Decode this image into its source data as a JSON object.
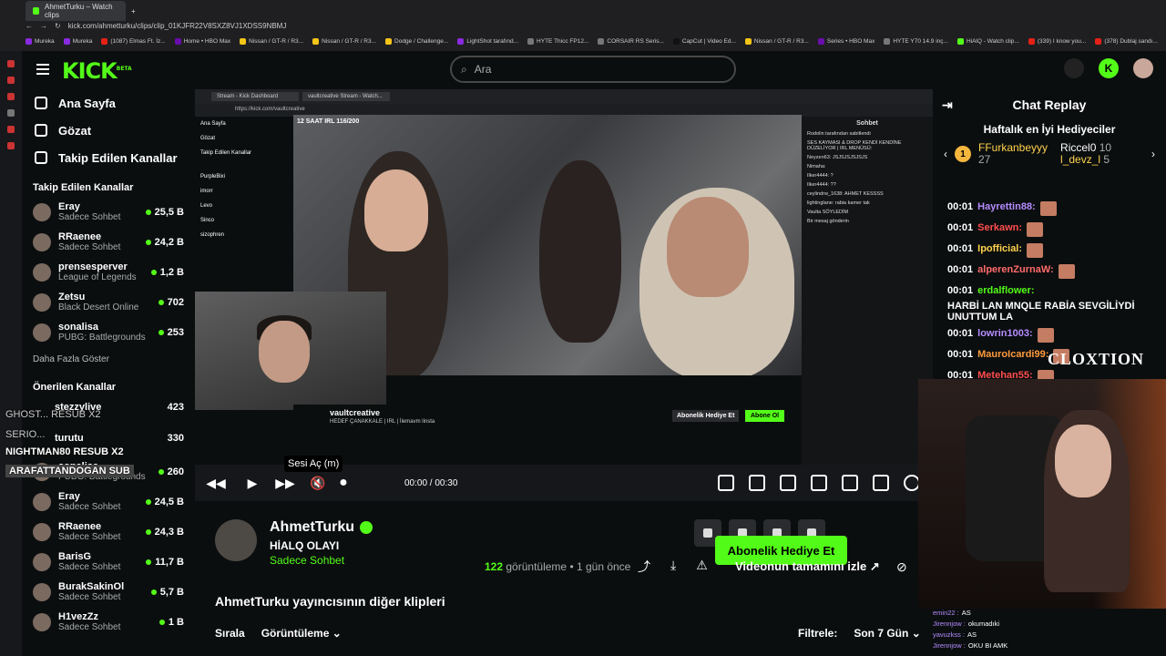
{
  "browser": {
    "tab_title": "AhmetTurku – Watch clips",
    "url": "kick.com/ahmetturku/clips/clip_01KJFR22V8SXZ8VJ1XDSS9NBMJ",
    "bookmarks": [
      "Mureka",
      "Mureka",
      "(1087) Elmas Ft. İz...",
      "Home • HBO Max",
      "Nissan / GT-R / R3...",
      "Nissan / GT-R / R3...",
      "Dodge / Challenge...",
      "LightShot tarafınd...",
      "HYTE Thicc FP12...",
      "CORSAIR RS Seris...",
      "CapCut | Video Ed...",
      "Nissan / GT-R / R3...",
      "Series • HBO Max",
      "HYTE Y70 14.9 inç...",
      "HiAlQ - Watch clip...",
      "(339) I know you...",
      "(378) Dublaj sandı..."
    ],
    "bookmark_colors": [
      "#8a2be2",
      "#8a2be2",
      "#e62117",
      "#6a0dad",
      "#f5c518",
      "#f5c518",
      "#f5c518",
      "#8a2be2",
      "#777777",
      "#777777",
      "#111111",
      "#f5c518",
      "#6a0dad",
      "#777777",
      "#53fc18",
      "#e62117",
      "#e62117"
    ]
  },
  "header": {
    "logo": "KICK",
    "logo_sup": "BETA",
    "search_placeholder": "Ara"
  },
  "sidebar": {
    "nav": [
      {
        "label": "Ana Sayfa",
        "icon": "home-icon"
      },
      {
        "label": "Gözat",
        "icon": "browse-icon"
      },
      {
        "label": "Takip Edilen Kanallar",
        "icon": "heart-icon"
      }
    ],
    "followed_title": "Takip Edilen Kanallar",
    "followed": [
      {
        "name": "Eray",
        "category": "Sadece Sohbet",
        "viewers": "25,5 B"
      },
      {
        "name": "RRaenee",
        "category": "Sadece Sohbet",
        "viewers": "24,2 B"
      },
      {
        "name": "prensesperver",
        "category": "League of Legends",
        "viewers": "1,2 B"
      },
      {
        "name": "Zetsu",
        "category": "Black Desert Online",
        "viewers": "702"
      },
      {
        "name": "sonalisa",
        "category": "PUBG: Battlegrounds",
        "viewers": "253"
      }
    ],
    "show_more": "Daha Fazla Göster",
    "recommended_title": "Önerilen Kanallar",
    "recommended": [
      {
        "name": "sonalisa",
        "category": "PUBG: Battlegrounds",
        "viewers": "260"
      },
      {
        "name": "Eray",
        "category": "Sadece Sohbet",
        "viewers": "24,5 B"
      },
      {
        "name": "RRaenee",
        "category": "Sadece Sohbet",
        "viewers": "24,3 B"
      },
      {
        "name": "BarisG",
        "category": "Sadece Sohbet",
        "viewers": "11,7 B"
      },
      {
        "name": "BurakSakinOl",
        "category": "Sadece Sohbet",
        "viewers": "5,7 B"
      },
      {
        "name": "H1vezZz",
        "category": "Sadece Sohbet",
        "viewers": "1 B"
      }
    ],
    "overlay_lines": [
      "GHOST...  RESUB X2",
      "SERIO...",
      "NIGHTMAN80   RESUB X2",
      "ARAFATTANDOGAN   SUB"
    ],
    "overlay_viewers": [
      "423",
      "330"
    ],
    "overlay_names": [
      "stezzylive",
      "turutu"
    ]
  },
  "player": {
    "inner_tabs": [
      "Stream - Kick Dashboard",
      "vaultcreative Stream - Watch..."
    ],
    "inner_url": "https://kick.com/vaultcreative",
    "inner_nav": [
      "Ana Sayfa",
      "Gözat",
      "Takip Edilen Kanallar"
    ],
    "inner_channels": [
      "PurpleBixi",
      "imorr",
      "Levo",
      "Sinco",
      "sizophren"
    ],
    "inner_chat_title": "Sohbet",
    "inner_chat_lines": [
      "Rodolin tarafından sabitlendi",
      "SES KAYMASI & DROP KENDİ KENDİNE DÜZELİYOR | IRL MENÜSÜ:",
      "Neyzen63: JSJSJSJSJSJS",
      "Nimaha:",
      "Ilker4444: ?",
      "Ilker4444: ??",
      "ceylindrw_1638: AHMET KESSSS",
      "lightinglane: rabia kamer tak",
      "Vaulta SÖYLEDİM",
      "Bir mesaj gönderin"
    ],
    "overlay_banner": "12 SAAT IRL 116/200",
    "streamer_name": "vaultcreative",
    "streamer_sub": "HEDEF ÇANAKKALE | IRL | İlemavm linsta",
    "abone_label": "Abone Ol",
    "gift_sub_label": "Abonelik Hediye Et",
    "tooltip": "Sesi Aç (m)",
    "time": "00:00 / 00:30",
    "progress": 0.36
  },
  "clip": {
    "channel": "AhmetTurku",
    "title": "HİALQ OLAYI",
    "category": "Sadece Sohbet",
    "gift_label": "Abonelik Hediye Et",
    "views_count": "122",
    "views_label": "görüntüleme",
    "age": "• 1 gün önce",
    "watch_full": "Videonun tamamını izle",
    "other_clips": "AhmetTurku yayıncısının diğer klipleri",
    "sort_label": "Sırala",
    "sort_value": "Görüntüleme",
    "filter_label": "Filtrele:",
    "filter_value": "Son 7 Gün"
  },
  "chat": {
    "title": "Chat Replay",
    "gifters_title": "Haftalık en İyi Hediyeciler",
    "top_gifter": {
      "name": "FFurkanbeyyy",
      "count": "27",
      "rank": "1"
    },
    "gifters": [
      {
        "name": "Riccel0",
        "count": "10"
      },
      {
        "name": "l_devz_l",
        "count": "5"
      }
    ],
    "messages": [
      {
        "time": "00:01",
        "user": "Hayrettin88:",
        "color": "#b58cff",
        "text": ""
      },
      {
        "time": "00:01",
        "user": "Serkawn:",
        "color": "#ff4d4d",
        "text": ""
      },
      {
        "time": "00:01",
        "user": "Ipofficial:",
        "color": "#ffd34d",
        "text": ""
      },
      {
        "time": "00:01",
        "user": "alperenZurnaW:",
        "color": "#ff6b6b",
        "text": ""
      },
      {
        "time": "00:01",
        "user": "erdalflower:",
        "color": "#53fc18",
        "text": "HARBİ LAN MNQLE RABİA SEVGİLİYDİ UNUTTUM LA"
      },
      {
        "time": "00:01",
        "user": "lowrin1003:",
        "color": "#b58cff",
        "text": ""
      },
      {
        "time": "00:01",
        "user": "MauroIcardi99:",
        "color": "#ff9b3d",
        "text": ""
      },
      {
        "time": "00:01",
        "user": "Metehan55:",
        "color": "#ff4d4d",
        "text": ""
      }
    ],
    "watermark": "CLOXTION",
    "cam_chat": [
      {
        "user": "emin22 :",
        "text": "AS"
      },
      {
        "user": "Jirennjow :",
        "text": "okumadıki"
      },
      {
        "user": "yavuzkss :",
        "text": "AS"
      },
      {
        "user": "Jirennjow :",
        "text": "OKU BI AMK"
      }
    ]
  }
}
